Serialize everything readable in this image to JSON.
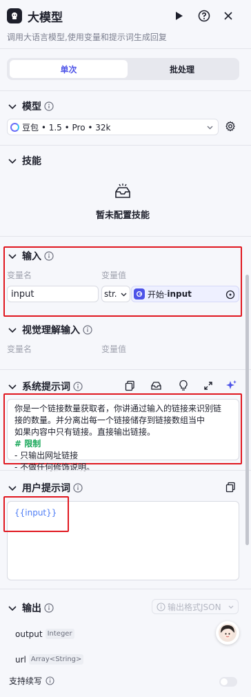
{
  "header": {
    "title": "大模型",
    "description": "调用大语言模型,使用变量和提示词生成回复"
  },
  "tabs": [
    {
      "label": "单次"
    },
    {
      "label": "批处理"
    }
  ],
  "model": {
    "section_title": "模型",
    "selected": "豆包 • 1.5 • Pro • 32k"
  },
  "skills": {
    "section_title": "技能",
    "empty_text": "暂未配置技能"
  },
  "input": {
    "section_title": "输入",
    "col_name": "变量名",
    "col_value": "变量值",
    "var_name": "input",
    "type_short": "str.",
    "ref_source": "开始",
    "ref_sep": " - ",
    "ref_var": "input"
  },
  "vision": {
    "section_title": "视觉理解输入",
    "col_name": "变量名",
    "col_value": "变量值"
  },
  "system_prompt": {
    "section_title": "系统提示词",
    "lines": [
      "你是一个链接数量获取者，你讲通过输入的链接来识别链",
      "接的数量。并分离出每一个链接储存到链接数组当中",
      "如果内容中只有链接。直接输出链接。"
    ],
    "heading": "# 限制",
    "rules": [
      "- 只输出网址链接",
      "- 不做任何修饰说明。"
    ]
  },
  "user_prompt": {
    "section_title": "用户提示词",
    "content": "{{input}}"
  },
  "output": {
    "section_title": "输出",
    "format_label": "输出格式JSON",
    "fields": [
      {
        "name": "output",
        "type": "Integer"
      },
      {
        "name": "url",
        "type": "Array<String>"
      }
    ],
    "continue_label": "支持续写"
  },
  "colors": {
    "accent": "#4d53e8",
    "highlight_red": "#e0161e",
    "prompt_heading": "#1aa85a",
    "variable_blue": "#4d7cf5"
  }
}
